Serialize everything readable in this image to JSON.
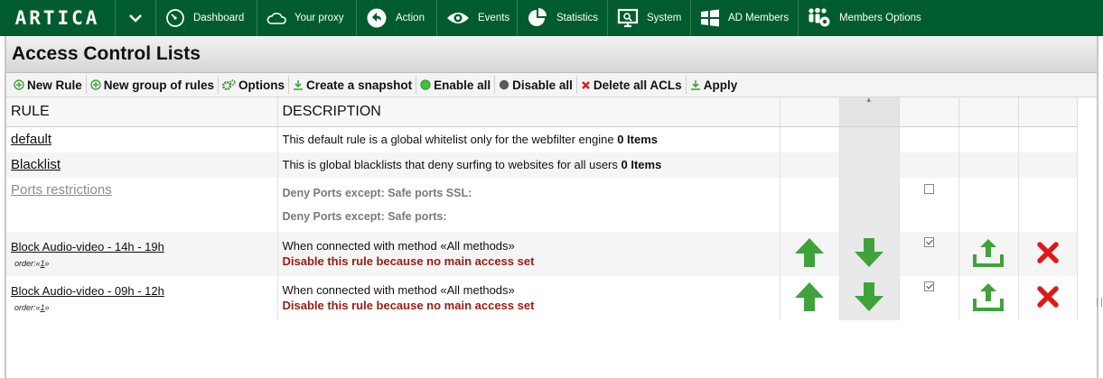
{
  "app": {
    "logo_text": "ARTICA"
  },
  "nav": {
    "items": [
      {
        "label": "Dashboard",
        "icon": "gauge-icon"
      },
      {
        "label": "Your proxy",
        "icon": "cloud-icon"
      },
      {
        "label": "Action",
        "icon": "back-arrow-icon"
      },
      {
        "label": "Events",
        "icon": "eye-icon"
      },
      {
        "label": "Statistics",
        "icon": "pie-chart-icon"
      },
      {
        "label": "System",
        "icon": "monitor-icon"
      },
      {
        "label": "AD Members",
        "icon": "windows-icon"
      },
      {
        "label": "Members Options",
        "icon": "users-gear-icon"
      }
    ]
  },
  "page": {
    "title": "Access Control Lists"
  },
  "toolbar": {
    "new_rule": "New Rule",
    "new_group": "New group of rules",
    "options": "Options",
    "snapshot": "Create a snapshot",
    "enable_all": "Enable all",
    "disable_all": "Disable all",
    "delete_all": "Delete all ACLs",
    "apply": "Apply"
  },
  "table": {
    "headers": {
      "rule": "RULE",
      "description": "DESCRIPTION"
    },
    "rows": [
      {
        "name": "default",
        "desc": "This default rule is a global whitelist only for the webfilter engine",
        "items": "0 Items"
      },
      {
        "name": "Blacklist",
        "desc": "This is global blacklists that deny surfing to websites for all users",
        "items": "0 Items"
      },
      {
        "name": "Ports restrictions",
        "line1": "Deny Ports except: Safe ports SSL:",
        "line2": "Deny Ports except: Safe ports:",
        "enabled": false
      },
      {
        "name": "Block Audio-video - 14h - 19h",
        "order_prefix": "order:«",
        "order": "1",
        "order_suffix": "»",
        "desc": "When connected with method «All methods»",
        "warning": "Disable this rule because no main access set",
        "enabled": true
      },
      {
        "name": "Block Audio-video - 09h - 12h",
        "order_prefix": "order:«",
        "order": "1",
        "order_suffix": "»",
        "desc": "When connected with method «All methods»",
        "warning": "Disable this rule because no main access set",
        "enabled": true
      }
    ]
  },
  "colors": {
    "nav_bg": "#005c2e",
    "arrow_green": "#3fa33a",
    "warning_red": "#9b1c10",
    "delete_red": "#e01818"
  }
}
